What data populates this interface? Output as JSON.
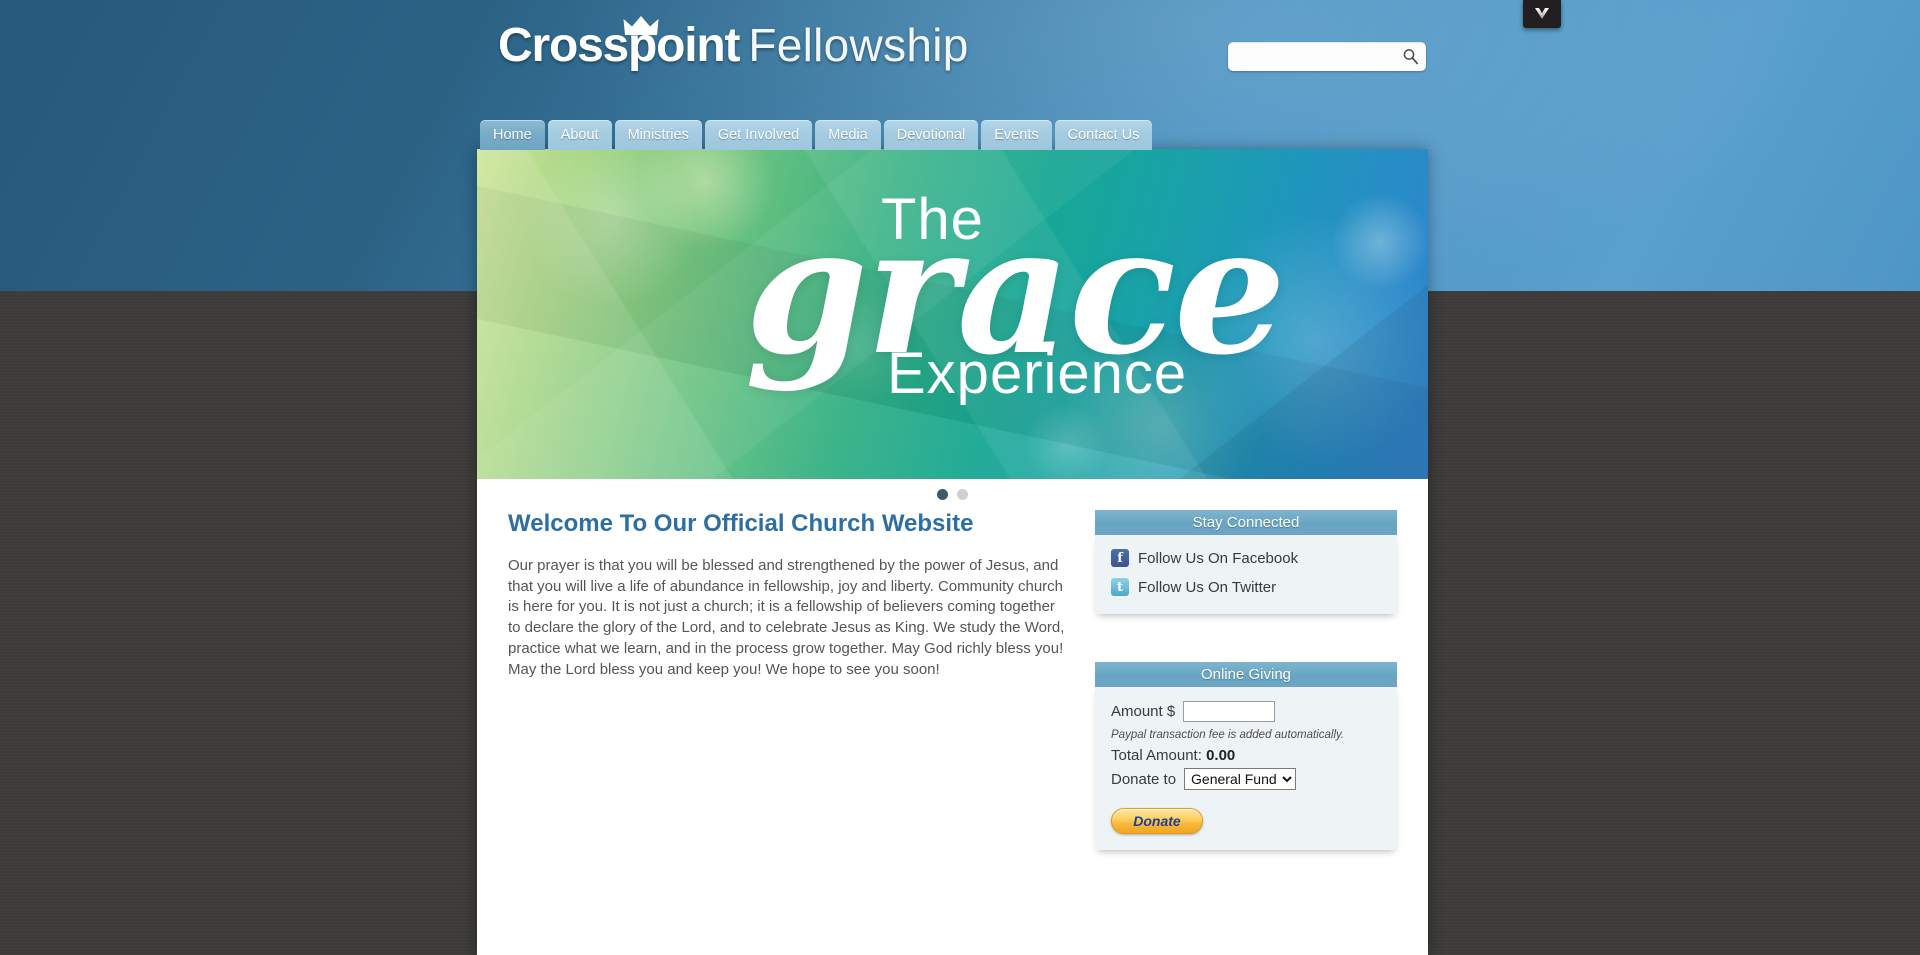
{
  "site": {
    "logo_bold": "Crosspoint",
    "logo_light": "Fellowship",
    "crown_icon": "crown-icon"
  },
  "search": {
    "value": "",
    "placeholder": "",
    "icon": "search-icon"
  },
  "nav": {
    "items": [
      {
        "label": "Home",
        "active": true
      },
      {
        "label": "About",
        "active": false
      },
      {
        "label": "Ministries",
        "active": false
      },
      {
        "label": "Get Involved",
        "active": false
      },
      {
        "label": "Media",
        "active": false
      },
      {
        "label": "Devotional",
        "active": false
      },
      {
        "label": "Events",
        "active": false
      },
      {
        "label": "Contact Us",
        "active": false
      }
    ]
  },
  "hero": {
    "line1": "The",
    "line2": "grace",
    "line3": "Experience",
    "dots": [
      {
        "state": "active"
      },
      {
        "state": "inactive"
      }
    ]
  },
  "main": {
    "title": "Welcome To Our Official Church Website",
    "paragraph": "Our prayer is that you will be blessed and strengthened by the power of Jesus, and that you will live a life of abundance in fellowship, joy and liberty. Community church is here for you. It is not just a church; it is a fellowship of believers coming together to declare the glory of the Lord, and to celebrate Jesus as King. We study the Word, practice what we learn, and in the process grow together. May God richly bless you! May the Lord bless you and keep you! We hope to see you soon!"
  },
  "stay_connected": {
    "heading": "Stay Connected",
    "links": [
      {
        "label": "Follow Us On Facebook",
        "icon": "facebook-icon",
        "glyph": "f"
      },
      {
        "label": "Follow Us On Twitter",
        "icon": "twitter-icon",
        "glyph": "t"
      }
    ]
  },
  "online_giving": {
    "heading": "Online Giving",
    "amount_label": "Amount $",
    "amount_value": "",
    "note": "Paypal transaction fee is added automatically.",
    "total_label": "Total Amount:",
    "total_value": "0.00",
    "donate_to_label": "Donate to",
    "selected_fund": "General Fund",
    "fund_options": [
      "General Fund"
    ],
    "donate_button": "Donate"
  },
  "download_chip": {
    "icon": "download-chevron-icon"
  },
  "colors": {
    "header_blue": "#2c6385",
    "header_blue_light": "#5aa0cd",
    "page_background": "#3d3c3a",
    "title_blue": "#2d6ea3",
    "widget_head": "#6aa6c4",
    "widget_body": "#eef3f6",
    "donate_orange": "#f6b93c",
    "donate_text_blue": "#1d3f94",
    "dot_active": "#3f5a6b",
    "dot_inactive": "#cfcfcf"
  }
}
